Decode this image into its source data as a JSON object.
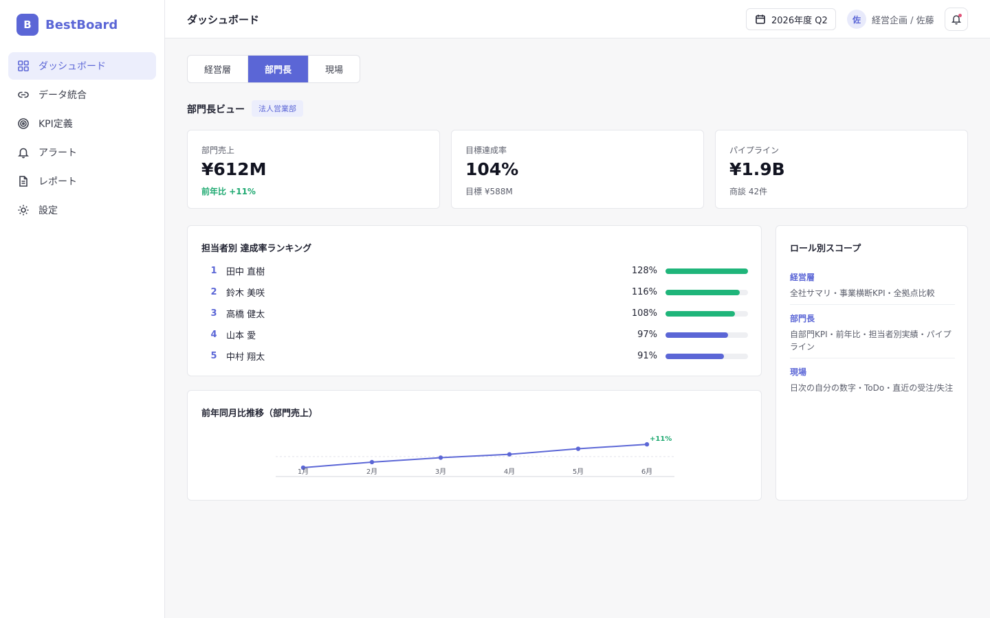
{
  "app": {
    "logo_letter": "B",
    "name": "BestBoard"
  },
  "sidebar": {
    "items": [
      {
        "label": "ダッシュボード",
        "icon": "grid-icon",
        "active": true
      },
      {
        "label": "データ統合",
        "icon": "link-icon",
        "active": false
      },
      {
        "label": "KPI定義",
        "icon": "target-icon",
        "active": false
      },
      {
        "label": "アラート",
        "icon": "bell-icon",
        "active": false
      },
      {
        "label": "レポート",
        "icon": "document-icon",
        "active": false
      },
      {
        "label": "設定",
        "icon": "gear-icon",
        "active": false
      }
    ]
  },
  "header": {
    "title": "ダッシュボード",
    "period": "2026年度 Q2",
    "avatar_initial": "佐",
    "user_label": "経営企画 / 佐藤"
  },
  "tabs": [
    {
      "label": "経営層",
      "active": false
    },
    {
      "label": "部門長",
      "active": true
    },
    {
      "label": "現場",
      "active": false
    }
  ],
  "view": {
    "title": "部門長ビュー",
    "department": "法人営業部"
  },
  "kpis": [
    {
      "label": "部門売上",
      "value": "¥612M",
      "sub": "前年比 +11%",
      "trend": "up"
    },
    {
      "label": "目標達成率",
      "value": "104%",
      "sub": "目標 ¥588M",
      "trend": "neutral"
    },
    {
      "label": "パイプライン",
      "value": "¥1.9B",
      "sub": "商談 42件",
      "trend": "neutral"
    }
  ],
  "ranking": {
    "title": "担当者別 達成率ランキング",
    "rows": [
      {
        "rank": "1",
        "name": "田中 直樹",
        "percent_label": "128%",
        "bar_fill": 1.0,
        "color": "#1fb57a"
      },
      {
        "rank": "2",
        "name": "鈴木 美咲",
        "percent_label": "116%",
        "bar_fill": 0.9,
        "color": "#1fb57a"
      },
      {
        "rank": "3",
        "name": "高橋 健太",
        "percent_label": "108%",
        "bar_fill": 0.84,
        "color": "#1fb57a"
      },
      {
        "rank": "4",
        "name": "山本 愛",
        "percent_label": "97%",
        "bar_fill": 0.76,
        "color": "#5b66d6"
      },
      {
        "rank": "5",
        "name": "中村 翔太",
        "percent_label": "91%",
        "bar_fill": 0.71,
        "color": "#5b66d6"
      }
    ]
  },
  "scope": {
    "title": "ロール別スコープ",
    "items": [
      {
        "title": "経営層",
        "desc": "全社サマリ・事業横断KPI・全拠点比較"
      },
      {
        "title": "部門長",
        "desc": "自部門KPI・前年比・担当者別実績・パイプライン"
      },
      {
        "title": "現場",
        "desc": "日次の自分の数字・ToDo・直近の受注/失注"
      }
    ]
  },
  "trend_card": {
    "title": "前年同月比推移（部門売上）"
  },
  "chart_data": {
    "type": "line",
    "categories": [
      "1月",
      "2月",
      "3月",
      "4月",
      "5月",
      "6月"
    ],
    "values": [
      1,
      3.5,
      5.5,
      7,
      9.5,
      11.5
    ],
    "ylim": [
      -3,
      14
    ],
    "baseline": 6,
    "grid": false,
    "annotation": "+11%",
    "line_color": "#5b66d6",
    "annotation_color": "#1fa971"
  },
  "colors": {
    "accent": "#5b66d6",
    "positive": "#1fa971"
  }
}
